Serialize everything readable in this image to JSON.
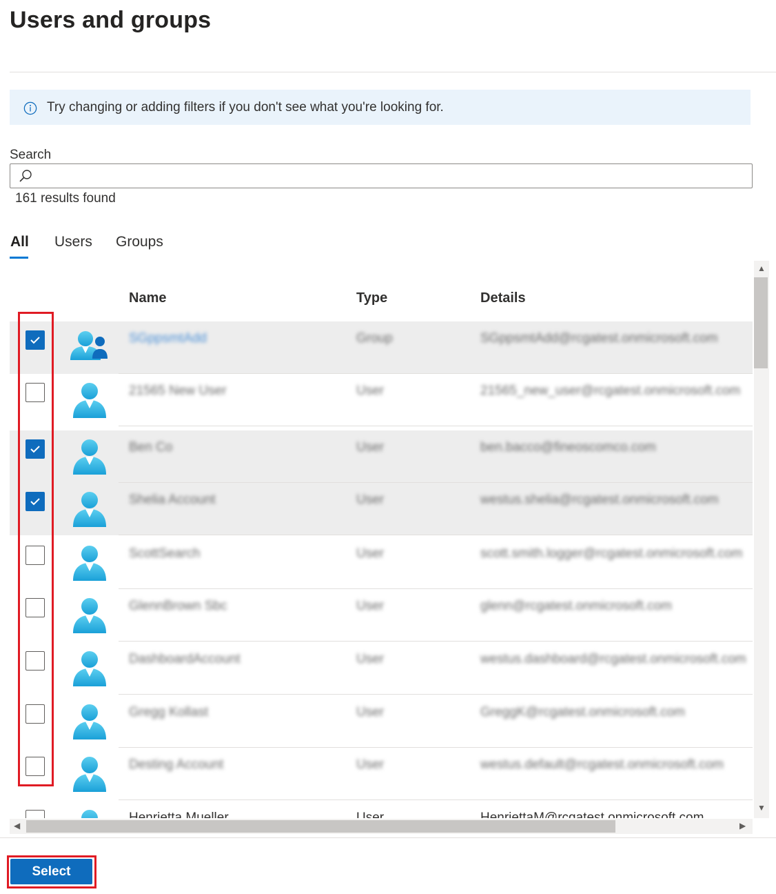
{
  "title": "Users and groups",
  "info": {
    "text": "Try changing or adding filters if you don't see what you're looking for."
  },
  "search": {
    "label": "Search",
    "value": "",
    "placeholder": ""
  },
  "results": "161 results found",
  "tabs": [
    {
      "label": "All",
      "active": true
    },
    {
      "label": "Users",
      "active": false
    },
    {
      "label": "Groups",
      "active": false
    }
  ],
  "columns": {
    "name": "Name",
    "type": "Type",
    "details": "Details"
  },
  "rows": [
    {
      "checked": true,
      "kind": "group",
      "name": "SGppsmtAdd",
      "type": "Group",
      "details": "SGppsmtAdd@rcgatest.onmicrosoft.com"
    },
    {
      "checked": false,
      "kind": "user",
      "name": "21565 New User",
      "type": "User",
      "details": "21565_new_user@rcgatest.onmicrosoft.com"
    },
    {
      "checked": true,
      "kind": "user",
      "name": "Ben Co",
      "type": "User",
      "details": "ben.bacco@fineoscomco.com"
    },
    {
      "checked": true,
      "kind": "user",
      "name": "Shelia Account",
      "type": "User",
      "details": "westus.shelia@rcgatest.onmicrosoft.com"
    },
    {
      "checked": false,
      "kind": "user",
      "name": "ScottSearch",
      "type": "User",
      "details": "scott.smith.logger@rcgatest.onmicrosoft.com"
    },
    {
      "checked": false,
      "kind": "user",
      "name": "GlennBrown Sbc",
      "type": "User",
      "details": "glenn@rcgatest.onmicrosoft.com"
    },
    {
      "checked": false,
      "kind": "user",
      "name": "DashboardAccount",
      "type": "User",
      "details": "westus.dashboard@rcgatest.onmicrosoft.com"
    },
    {
      "checked": false,
      "kind": "user",
      "name": "Gregg Kollast",
      "type": "User",
      "details": "GreggK@rcgatest.onmicrosoft.com"
    },
    {
      "checked": false,
      "kind": "user",
      "name": "Desting Account",
      "type": "User",
      "details": "westus.default@rcgatest.onmicrosoft.com"
    },
    {
      "checked": false,
      "kind": "user",
      "name": "Henrietta Mueller",
      "type": "User",
      "details": "HenriettaM@rcgatest.onmicrosoft.com",
      "clear": true
    }
  ],
  "select_button": "Select",
  "colors": {
    "accent": "#0f6cbd",
    "highlight": "#e01b24",
    "info_bg": "#eaf3fb",
    "selected_row": "#ededed"
  }
}
